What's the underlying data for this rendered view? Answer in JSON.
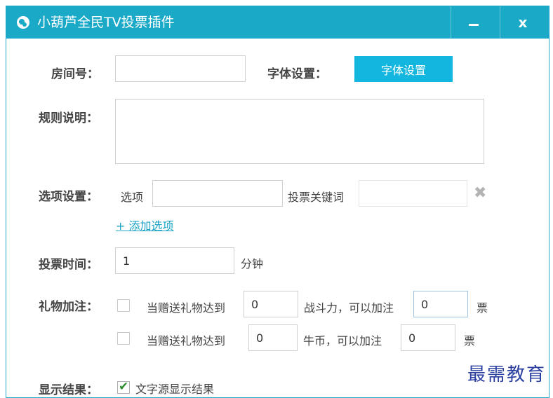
{
  "window": {
    "title": "小葫芦全民TV投票插件",
    "minimize_label": "",
    "close_label": "x",
    "accent_color": "#1ba9c8"
  },
  "room": {
    "label": "房间号：",
    "value": ""
  },
  "font": {
    "label": "字体设置：",
    "button_label": "字体设置"
  },
  "rules": {
    "label": "规则说明：",
    "value": ""
  },
  "options": {
    "label": "选项设置：",
    "option_label": "选项",
    "option_value": "",
    "keyword_label": "投票关键词",
    "keyword_value": "",
    "add_link": "+ 添加选项"
  },
  "vote_time": {
    "label": "投票时间：",
    "value": "1",
    "unit": "分钟"
  },
  "gifts": {
    "label": "礼物加注：",
    "rows": [
      {
        "checked": false,
        "prefix": "当赠送礼物达到",
        "threshold": "0",
        "middle": "战斗力，可以加注",
        "bonus": "0",
        "suffix": "票"
      },
      {
        "checked": false,
        "prefix": "当赠送礼物达到",
        "threshold": "0",
        "middle": "牛币，可以加注",
        "bonus": "0",
        "suffix": "票"
      }
    ]
  },
  "display": {
    "label": "显示结果：",
    "checkbox_checked": true,
    "checkbox_text": "文字源显示结果"
  },
  "watermark": "最需教育"
}
